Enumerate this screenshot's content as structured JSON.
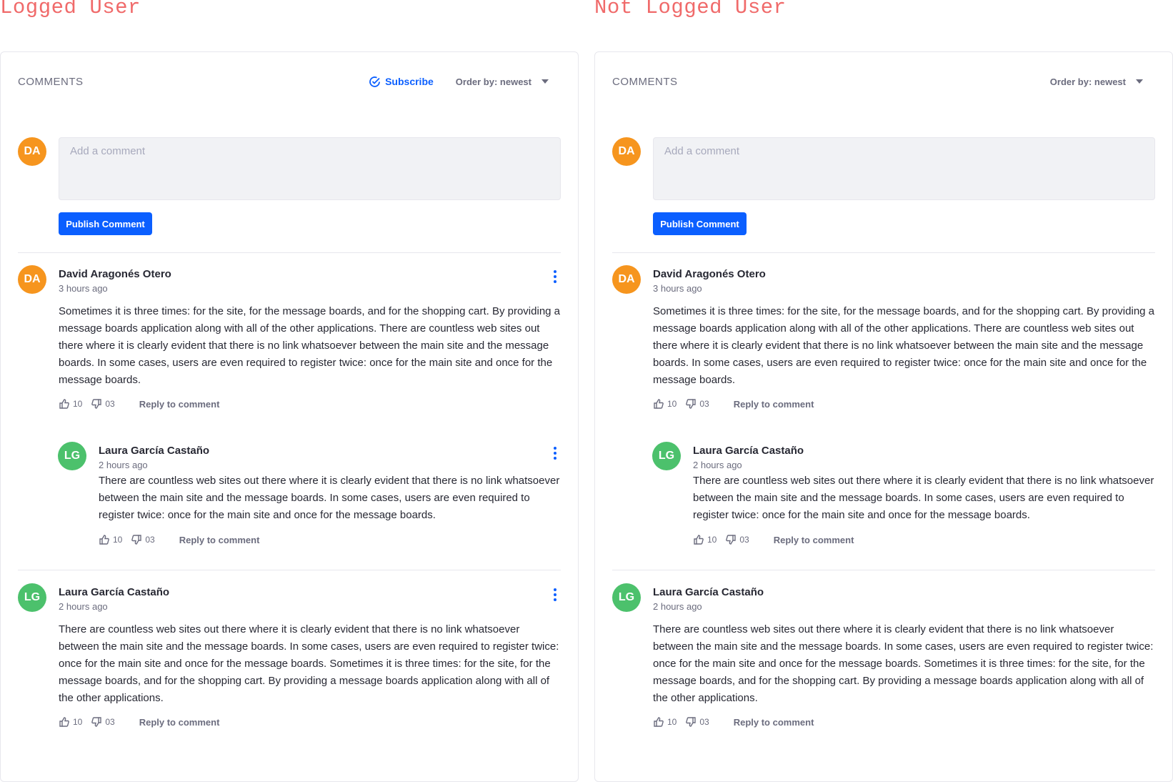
{
  "panels": {
    "logged_title": "Logged User",
    "not_logged_title": "Not Logged User"
  },
  "header": {
    "comments_label": "COMMENTS",
    "subscribe_label": "Subscribe",
    "order_label": "Order by: newest"
  },
  "composer": {
    "avatar_initials": "DA",
    "placeholder": "Add a comment",
    "publish_label": "Publish Comment"
  },
  "comments": [
    {
      "initials": "DA",
      "author": "David Aragonés Otero",
      "time": "3 hours ago",
      "text": "Sometimes it is three times: for the site, for the message boards, and for the shopping cart. By providing a message boards application along with all of the other applications. There are countless web sites out there where it is clearly evident that there is no link whatsoever between the main site and the message boards. In some cases, users are even required to register twice: once for the main site and once for the message boards.",
      "likes": "10",
      "dislikes": "03",
      "reply_label": "Reply to comment"
    },
    {
      "initials": "LG",
      "author": "Laura García Castaño",
      "time": "2 hours ago",
      "text": "There are countless web sites out there where it is clearly evident that there is no link whatsoever between the main site and the message boards. In some cases, users are even required to register twice: once for the main site and once for the message boards.",
      "likes": "10",
      "dislikes": "03",
      "reply_label": "Reply to comment"
    },
    {
      "initials": "LG",
      "author": "Laura García Castaño",
      "time": "2 hours ago",
      "text": "There are countless web sites out there where it is clearly evident that there is no link whatsoever between the main site and the message boards. In some cases, users are even required to register twice: once for the main site and once for the message boards. Sometimes it is three times: for the site, for the message boards, and for the shopping cart. By providing a message boards application along with all of the other applications.",
      "likes": "10",
      "dislikes": "03",
      "reply_label": "Reply to comment"
    }
  ],
  "colors": {
    "accent": "#0b5fff",
    "title_red": "#f06a6a",
    "avatar_orange": "#f6951e",
    "avatar_green": "#4cc16c"
  }
}
